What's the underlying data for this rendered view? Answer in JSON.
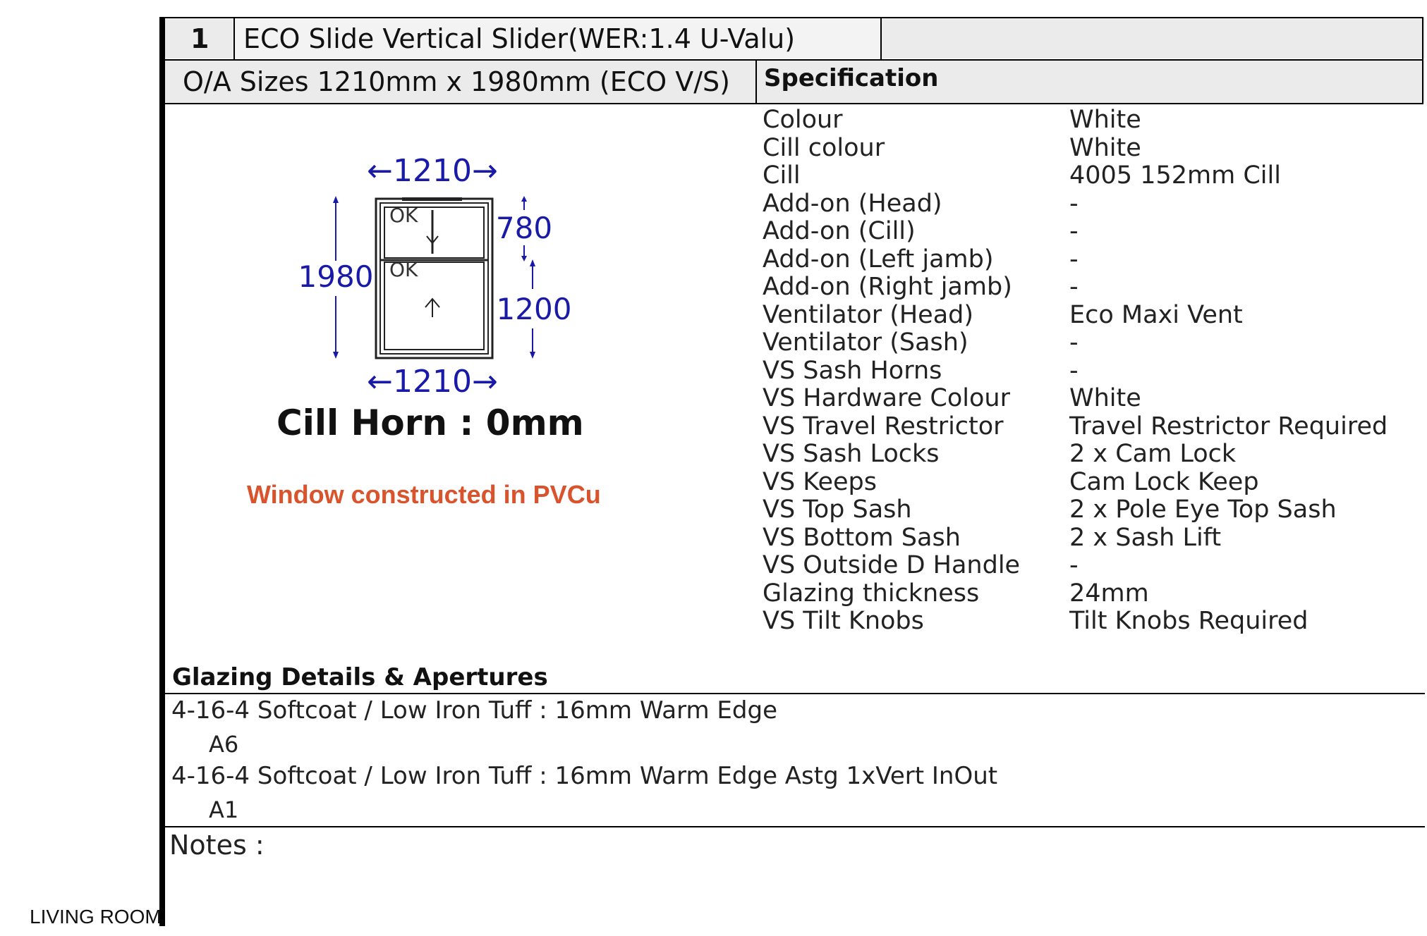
{
  "item": {
    "number": "1",
    "title": "ECO Slide Vertical Slider(WER:1.4 U-Valu)",
    "sizes": "O/A Sizes 1210mm x 1980mm (ECO V/S)"
  },
  "specification": {
    "heading": "Specification",
    "rows": [
      {
        "label": "Colour",
        "value": "White"
      },
      {
        "label": "Cill colour",
        "value": "White"
      },
      {
        "label": "Cill",
        "value": "4005 152mm Cill"
      },
      {
        "label": "Add-on (Head)",
        "value": "-"
      },
      {
        "label": "Add-on (Cill)",
        "value": "-"
      },
      {
        "label": "Add-on (Left jamb)",
        "value": "-"
      },
      {
        "label": "Add-on (Right jamb)",
        "value": "-"
      },
      {
        "label": "Ventilator (Head)",
        "value": "Eco Maxi Vent"
      },
      {
        "label": "Ventilator (Sash)",
        "value": "-"
      },
      {
        "label": "VS Sash Horns",
        "value": "-"
      },
      {
        "label": "VS Hardware Colour",
        "value": "White"
      },
      {
        "label": "VS Travel Restrictor",
        "value": "Travel Restrictor Required"
      },
      {
        "label": "VS Sash Locks",
        "value": "2 x Cam Lock"
      },
      {
        "label": "VS Keeps",
        "value": "Cam Lock Keep"
      },
      {
        "label": "VS Top Sash",
        "value": "2 x Pole Eye Top Sash"
      },
      {
        "label": "VS Bottom Sash",
        "value": "2 x Sash Lift"
      },
      {
        "label": "VS Outside D Handle",
        "value": "-"
      },
      {
        "label": "Glazing thickness",
        "value": "24mm"
      },
      {
        "label": "VS Tilt Knobs",
        "value": "Tilt Knobs Required"
      }
    ]
  },
  "drawing": {
    "width_top": "←1210→",
    "width_bottom": "←1210→",
    "height_total": "1980",
    "height_top": "780",
    "height_bottom": "1200",
    "top_pane_label": "OK",
    "bottom_pane_label": "OK",
    "cill_horn": "Cill Horn : 0mm",
    "material_note": "Window constructed in PVCu",
    "dimension_color": "#1a1aa8",
    "note_color": "#d9532c"
  },
  "glazing": {
    "heading": "Glazing Details & Apertures",
    "entries": [
      {
        "spec": "4-16-4 Softcoat / Low Iron Tuff : 16mm Warm Edge",
        "aperture": "A6"
      },
      {
        "spec": "4-16-4 Softcoat / Low Iron Tuff : 16mm Warm Edge  Astg 1xVert InOut",
        "aperture": "A1"
      }
    ]
  },
  "notes_label": "Notes :",
  "room_label": "LIVING ROOM"
}
